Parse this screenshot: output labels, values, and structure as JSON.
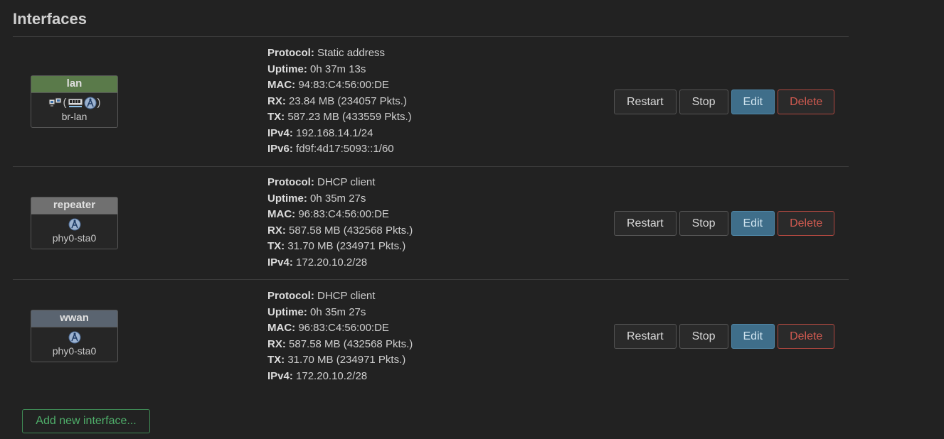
{
  "section_title": "Interfaces",
  "interfaces": [
    {
      "name": "lan",
      "device": "br-lan",
      "color": "#5a7a4a",
      "details": [
        {
          "label": "Protocol:",
          "value": "Static address"
        },
        {
          "label": "Uptime:",
          "value": "0h 37m 13s"
        },
        {
          "label": "MAC:",
          "value": "94:83:C4:56:00:DE"
        },
        {
          "label": "RX:",
          "value": "23.84 MB (234057 Pkts.)"
        },
        {
          "label": "TX:",
          "value": "587.23 MB (433559 Pkts.)"
        },
        {
          "label": "IPv4:",
          "value": "192.168.14.1/24"
        },
        {
          "label": "IPv6:",
          "value": "fd9f:4d17:5093::1/60"
        }
      ]
    },
    {
      "name": "repeater",
      "device": "phy0-sta0",
      "color": "#707070",
      "details": [
        {
          "label": "Protocol:",
          "value": "DHCP client"
        },
        {
          "label": "Uptime:",
          "value": "0h 35m 27s"
        },
        {
          "label": "MAC:",
          "value": "96:83:C4:56:00:DE"
        },
        {
          "label": "RX:",
          "value": "587.58 MB (432568 Pkts.)"
        },
        {
          "label": "TX:",
          "value": "31.70 MB (234971 Pkts.)"
        },
        {
          "label": "IPv4:",
          "value": "172.20.10.2/28"
        }
      ]
    },
    {
      "name": "wwan",
      "device": "phy0-sta0",
      "color": "#5a6470",
      "details": [
        {
          "label": "Protocol:",
          "value": "DHCP client"
        },
        {
          "label": "Uptime:",
          "value": "0h 35m 27s"
        },
        {
          "label": "MAC:",
          "value": "96:83:C4:56:00:DE"
        },
        {
          "label": "RX:",
          "value": "587.58 MB (432568 Pkts.)"
        },
        {
          "label": "TX:",
          "value": "31.70 MB (234971 Pkts.)"
        },
        {
          "label": "IPv4:",
          "value": "172.20.10.2/28"
        }
      ]
    }
  ],
  "buttons": {
    "restart": "Restart",
    "stop": "Stop",
    "edit": "Edit",
    "delete": "Delete"
  },
  "lan_icon_paren_open": "(",
  "lan_icon_paren_close": ")",
  "add_interface_label": "Add new interface...",
  "icons": {
    "lan": [
      "bridge-icon",
      "ethernet-icon",
      "wireless-icon"
    ],
    "repeater": [
      "wireless-icon"
    ],
    "wwan": [
      "wireless-icon"
    ]
  },
  "colors": {
    "background": "#222222",
    "edit_button": "#3f6e8a",
    "delete_border": "#b04840",
    "add_button": "#4fae6a"
  }
}
